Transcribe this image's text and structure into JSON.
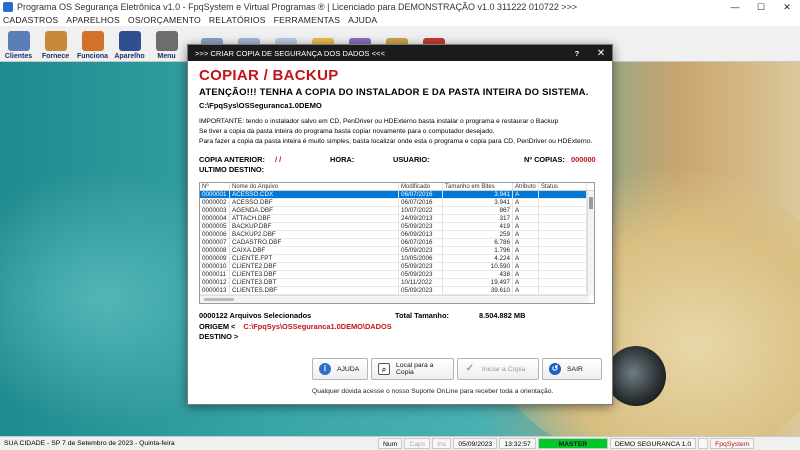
{
  "window": {
    "title": "Programa OS Segurança Eletrônica v1.0 - FpqSystem e Virtual Programas ® | Licenciado para DEMONSTRAÇÃO v1.0 311222 010722 >>>",
    "minimize": "—",
    "maximize": "☐",
    "close": "✕"
  },
  "menu": [
    "CADASTROS",
    "APARELHOS",
    "OS/ORÇAMENTO",
    "RELATÓRIOS",
    "FERRAMENTAS",
    "AJUDA"
  ],
  "toolbar": [
    {
      "label": "Clientes",
      "icon": "users-icon",
      "color": "#5a7fb8"
    },
    {
      "label": "Fornece",
      "icon": "supplier-icon",
      "color": "#c68a3a"
    },
    {
      "label": "Funciona",
      "icon": "employee-icon",
      "color": "#d0722a"
    },
    {
      "label": "Aparelho",
      "icon": "device-icon",
      "color": "#2f4f8f"
    },
    {
      "label": "Menu",
      "icon": "menu-icon",
      "color": "#6d6d6d"
    },
    {
      "label": "",
      "icon": "tool-icon",
      "color": "#8aa2c0"
    },
    {
      "label": "",
      "icon": "chart-icon",
      "color": "#a0b4d2"
    },
    {
      "label": "",
      "icon": "cloud-icon",
      "color": "#b6c8e2"
    },
    {
      "label": "",
      "icon": "calculator-icon",
      "color": "#e9b94a"
    },
    {
      "label": "",
      "icon": "gift-icon",
      "color": "#8a6ab8"
    },
    {
      "label": "",
      "icon": "coin-icon",
      "color": "#caa24a"
    },
    {
      "label": "",
      "icon": "exit-icon",
      "color": "#c23a2e"
    }
  ],
  "dialog": {
    "title": ">>> CRIAR COPIA DE SEGURANÇA DOS DADOS <<<",
    "help": "?",
    "close": "✕",
    "heading": "COPIAR / BACKUP",
    "warning": "ATENÇÃO!!! TENHA A COPIA DO INSTALADOR E DA PASTA INTEIRA DO SISTEMA.",
    "path": "C:\\FpqSys\\OSSeguranca1.0DEMO",
    "info": [
      "IMPORTANTE: tendo o instalador salvo em CD, PenDriver ou HDExterno basta instalar o programa e restaurar o Backup",
      "Se tiver a copia da pasta inteira do programa basta copiar novamente para o computador desejado.",
      "Para fazer a copia da pasta inteira é muito simples, basta localizar onde esta o programa e copia para CD, PenDriver ou HDExterno."
    ],
    "copia_anterior_label": "COPIA ANTERIOR:",
    "copia_anterior_value": "/ /",
    "hora_label": "HORA:",
    "usuario_label": "USUARIO:",
    "n_copias_label": "Nº COPIAS:",
    "n_copias_value": "000000",
    "ultimo_destino_label": "ULTIMO DESTINO:",
    "table": {
      "columns": [
        "Nº",
        "Nome do Arquivo",
        "Modificado",
        "Tamanho em Bites",
        "Atributo",
        "Status"
      ],
      "rows": [
        [
          "0000001",
          "ACESSO.CDX",
          "06/07/2016",
          "3.941",
          "A",
          ""
        ],
        [
          "0000002",
          "ACESSO.DBF",
          "06/07/2016",
          "3.941",
          "A",
          ""
        ],
        [
          "0000003",
          "AGENDA.DBF",
          "10/07/2022",
          "867",
          "A",
          ""
        ],
        [
          "0000004",
          "ATTACH.DBF",
          "24/09/2013",
          "317",
          "A",
          ""
        ],
        [
          "0000005",
          "BACKUP.DBF",
          "05/09/2023",
          "419",
          "A",
          ""
        ],
        [
          "0000006",
          "BACKUP2.DBF",
          "06/09/2013",
          "259",
          "A",
          ""
        ],
        [
          "0000007",
          "CADASTRO.DBF",
          "06/07/2016",
          "6.786",
          "A",
          ""
        ],
        [
          "0000008",
          "CAIXA.DBF",
          "05/09/2023",
          "1.796",
          "A",
          ""
        ],
        [
          "0000009",
          "CLIENTE.FPT",
          "10/05/2006",
          "4.224",
          "A",
          ""
        ],
        [
          "0000010",
          "CLIENTE2.DBF",
          "05/09/2023",
          "10.590",
          "A",
          ""
        ],
        [
          "0000011",
          "CLIENTE3.DBF",
          "05/09/2023",
          "438",
          "A",
          ""
        ],
        [
          "0000012",
          "CLIENTE3.DBT",
          "10/11/2022",
          "19.497",
          "A",
          ""
        ],
        [
          "0000013",
          "CLIENTES.DBF",
          "05/09/2023",
          "39.610",
          "A",
          ""
        ]
      ]
    },
    "files_selected": "0000122 Arquivos Selecionados",
    "total_label": "Total Tamanho:",
    "total_value": "8.504.882 MB",
    "origem_label": "ORIGEM <",
    "origem_value": "C:\\FpqSys\\OSSeguranca1.0DEMO\\DADOS",
    "destino_label": "DESTINO >",
    "buttons": {
      "ajuda": "AJUDA",
      "local": "Local para a Copia",
      "iniciar": "Iniciar a Copia",
      "sair": "SAIR"
    },
    "footer": "Qualquer dúvida acesse o nosso Suporte OnLine para receber toda a orientação."
  },
  "status": {
    "location": "SUA CIDADE - SP 7 de Setembro de 2023 - Quinta-feira",
    "num": "Num",
    "caps": "Caps",
    "ins": "Ins",
    "date": "05/09/2023",
    "time": "13:32:57",
    "master": "MASTER",
    "program": "DEMO SEGURANCA 1.0",
    "fpq": "FpqSystem"
  }
}
